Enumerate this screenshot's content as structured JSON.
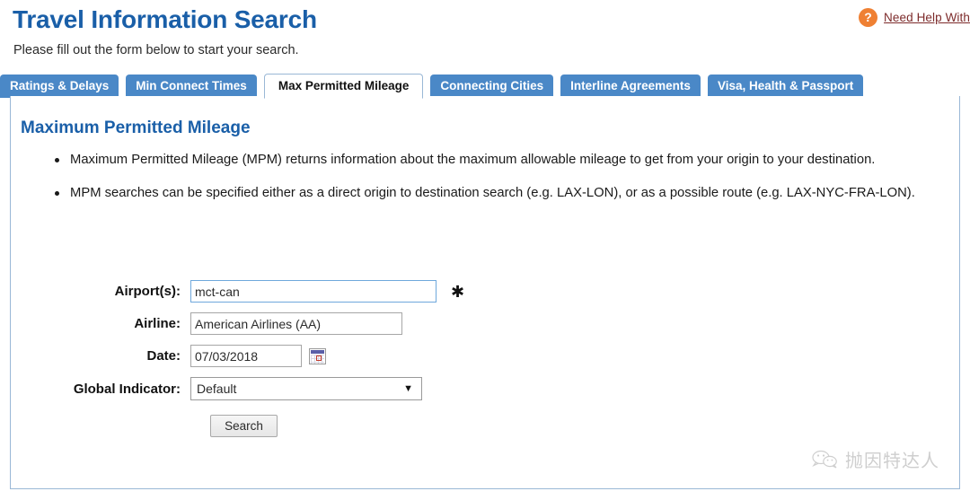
{
  "header": {
    "title": "Travel Information Search",
    "subtitle": "Please fill out the form below to start your search.",
    "help_icon": "question-mark-icon",
    "help_link": "Need Help With"
  },
  "tabs": [
    {
      "label": "Ratings & Delays",
      "active": false
    },
    {
      "label": "Min Connect Times",
      "active": false
    },
    {
      "label": "Max Permitted Mileage",
      "active": true
    },
    {
      "label": "Connecting Cities",
      "active": false
    },
    {
      "label": "Interline Agreements",
      "active": false
    },
    {
      "label": "Visa, Health & Passport",
      "active": false
    }
  ],
  "content": {
    "section_title": "Maximum Permitted Mileage",
    "bullets": [
      "Maximum Permitted Mileage (MPM) returns information about the maximum allowable mileage to get from your origin to your destination.",
      "MPM searches can be specified either as a direct origin to destination search (e.g. LAX-LON), or as a possible route (e.g. LAX-NYC-FRA-LON)."
    ]
  },
  "form": {
    "airports": {
      "label": "Airport(s):",
      "value": "mct-can",
      "placeholder": "",
      "required_marker": "✱"
    },
    "airline": {
      "label": "Airline:",
      "value": "American Airlines (AA)",
      "placeholder": ""
    },
    "date": {
      "label": "Date:",
      "value": "07/03/2018",
      "placeholder": "",
      "calendar_icon": "calendar-icon"
    },
    "global_indicator": {
      "label": "Global Indicator:",
      "value": "Default",
      "arrow_icon": "chevron-down-icon"
    },
    "search_button": "Search"
  },
  "watermark": {
    "logo": "wechat-icon",
    "text": "抛因特达人"
  },
  "colors": {
    "brand_blue": "#1a5fa8",
    "tab_blue": "#4a88c7",
    "panel_border": "#9ab8d6",
    "help_orange": "#ef8033",
    "help_link": "#7d2b2b"
  }
}
